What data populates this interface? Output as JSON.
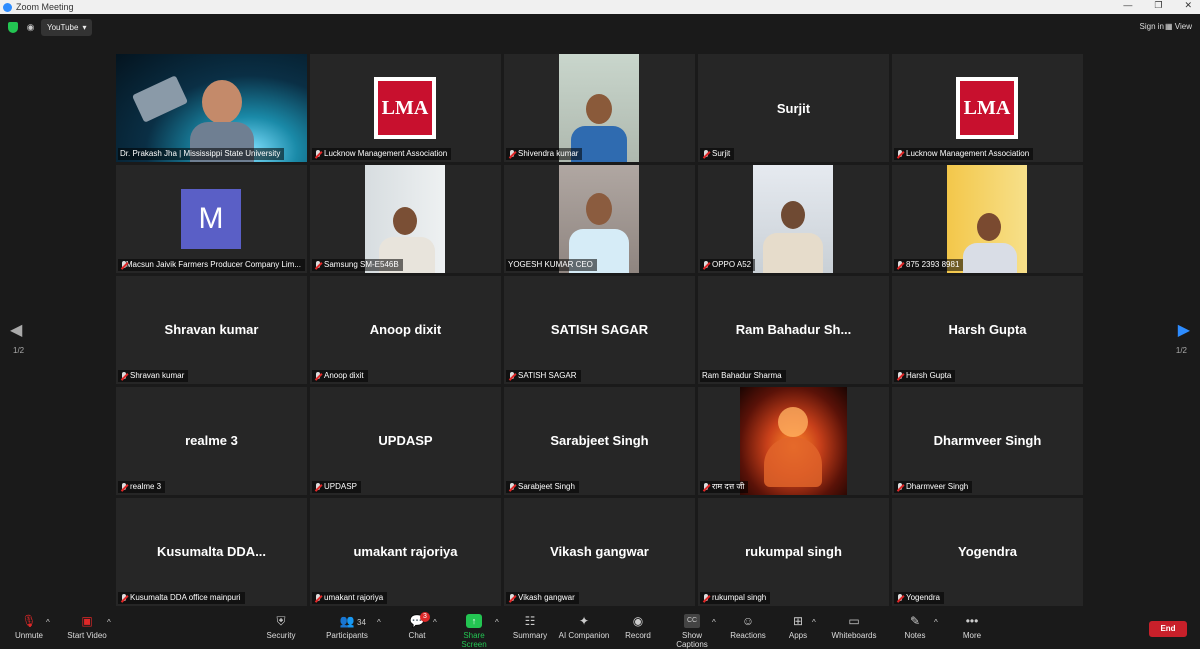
{
  "window": {
    "title": "Zoom Meeting"
  },
  "topbar": {
    "stream_label": "YouTube",
    "signin": "Sign in",
    "view": "View"
  },
  "pagination": {
    "left": "1/2",
    "right": "1/2"
  },
  "tiles": [
    {
      "kind": "video",
      "label": "Dr. Prakash Jha | Mississippi State University",
      "muted": false,
      "active": true
    },
    {
      "kind": "logo",
      "big": "LMA",
      "label": "Lucknow Management Association",
      "muted": true
    },
    {
      "kind": "video",
      "label": "Shivendra kumar",
      "muted": true
    },
    {
      "kind": "name",
      "big": "Surjit",
      "label": "Surjit",
      "muted": true
    },
    {
      "kind": "logo",
      "big": "LMA",
      "label": "Lucknow Management Association",
      "muted": true
    },
    {
      "kind": "avatar",
      "big": "M",
      "label": "Macsun Jaivik Farmers Producer Company Lim...",
      "muted": true
    },
    {
      "kind": "video",
      "label": "Samsung SM-E546B",
      "muted": true
    },
    {
      "kind": "video",
      "label": "YOGESH KUMAR CEO",
      "muted": false
    },
    {
      "kind": "video",
      "label": "OPPO A52",
      "muted": true
    },
    {
      "kind": "video",
      "label": "875 2393 8981",
      "muted": true
    },
    {
      "kind": "name",
      "big": "Shravan kumar",
      "label": "Shravan kumar",
      "muted": true
    },
    {
      "kind": "name",
      "big": "Anoop dixit",
      "label": "Anoop dixit",
      "muted": true
    },
    {
      "kind": "name",
      "big": "SATISH SAGAR",
      "label": "SATISH SAGAR",
      "muted": true
    },
    {
      "kind": "name",
      "big": "Ram  Bahadur  Sh...",
      "label": "Ram Bahadur Sharma",
      "muted": false
    },
    {
      "kind": "name",
      "big": "Harsh Gupta",
      "label": "Harsh Gupta",
      "muted": true
    },
    {
      "kind": "name",
      "big": "realme 3",
      "label": "realme 3",
      "muted": true
    },
    {
      "kind": "name",
      "big": "UPDASP",
      "label": "UPDASP",
      "muted": true
    },
    {
      "kind": "name",
      "big": "Sarabjeet Singh",
      "label": "Sarabjeet Singh",
      "muted": true
    },
    {
      "kind": "picture",
      "label": "राम दत्त जी",
      "muted": true
    },
    {
      "kind": "name",
      "big": "Dharmveer Singh",
      "label": "Dharmveer Singh",
      "muted": true
    },
    {
      "kind": "name",
      "big": "Kusumalta  DDA...",
      "label": "Kusumalta DDA office mainpuri",
      "muted": true
    },
    {
      "kind": "name",
      "big": "umakant rajoriya",
      "label": "umakant rajoriya",
      "muted": true
    },
    {
      "kind": "name",
      "big": "Vikash gangwar",
      "label": "Vikash gangwar",
      "muted": true
    },
    {
      "kind": "name",
      "big": "rukumpal singh",
      "label": "rukumpal singh",
      "muted": true
    },
    {
      "kind": "name",
      "big": "Yogendra",
      "label": "Yogendra",
      "muted": true
    }
  ],
  "toolbar": {
    "unmute": "Unmute",
    "start_video": "Start Video",
    "security": "Security",
    "participants": "Participants",
    "participants_count": "34",
    "chat": "Chat",
    "chat_badge": "3",
    "share_screen": "Share Screen",
    "summary": "Summary",
    "ai_companion": "AI Companion",
    "record": "Record",
    "show_captions": "Show Captions",
    "reactions": "Reactions",
    "apps": "Apps",
    "whiteboards": "Whiteboards",
    "notes": "Notes",
    "more": "More",
    "end": "End",
    "cc_glyph": "CC"
  },
  "colors": {
    "accent": "#2d8cff",
    "share_green": "#23c552",
    "end_red": "#c8202a",
    "active_border": "#d8e86b"
  }
}
